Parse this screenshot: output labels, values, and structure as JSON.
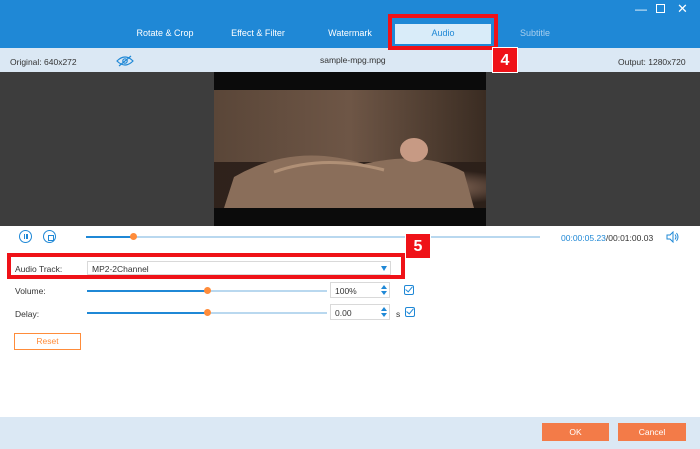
{
  "tabs": [
    {
      "label": "Rotate & Crop"
    },
    {
      "label": "Effect & Filter"
    },
    {
      "label": "Watermark"
    },
    {
      "label": "Audio"
    },
    {
      "label": "Subtitle"
    }
  ],
  "active_tab": "Audio",
  "info": {
    "original": "Original: 640x272",
    "filename": "sample-mpg.mpg",
    "output": "Output: 1280x720"
  },
  "playback": {
    "current_time": "00:00:05.23",
    "total_time": "/00:01:00.03",
    "progress": 0.104
  },
  "audio": {
    "track_label": "Audio Track:",
    "track_value": "MP2-2Channel",
    "volume_label": "Volume:",
    "volume_value": "100%",
    "volume_level": 0.5,
    "delay_label": "Delay:",
    "delay_value": "0.00",
    "delay_unit": "s",
    "delay_level": 0.5
  },
  "buttons": {
    "reset": "Reset",
    "ok": "OK",
    "cancel": "Cancel"
  },
  "callouts": {
    "step_audio": "4",
    "step_track": "5"
  },
  "colors": {
    "accent": "#1f88d6",
    "orange": "#ff8c3a",
    "callout_red": "#ef1218"
  }
}
